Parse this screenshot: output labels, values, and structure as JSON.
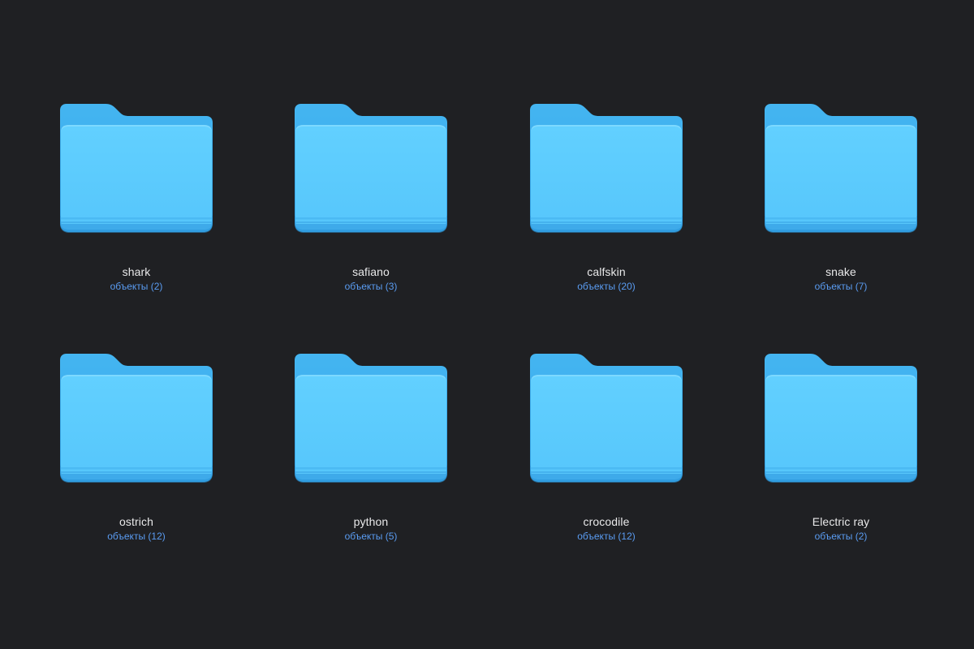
{
  "colors": {
    "background": "#1f2023",
    "folder_back": "#3fb0ee",
    "folder_front": "#5ccdff",
    "folder_bottom": "#48b4f0",
    "name_text": "#e9e9ea",
    "count_text": "#5a9cf2"
  },
  "folders": [
    {
      "name": "shark",
      "count": "объекты (2)",
      "icon": "folder-icon"
    },
    {
      "name": "safiano",
      "count": "объекты (3)",
      "icon": "folder-icon"
    },
    {
      "name": "calfskin",
      "count": "объекты (20)",
      "icon": "folder-icon"
    },
    {
      "name": "snake",
      "count": "объекты (7)",
      "icon": "folder-icon"
    },
    {
      "name": "ostrich",
      "count": "объекты (12)",
      "icon": "folder-icon"
    },
    {
      "name": "python",
      "count": "объекты (5)",
      "icon": "folder-icon"
    },
    {
      "name": "crocodile",
      "count": "объекты (12)",
      "icon": "folder-icon"
    },
    {
      "name": "Electric ray",
      "count": "объекты (2)",
      "icon": "folder-icon"
    }
  ]
}
